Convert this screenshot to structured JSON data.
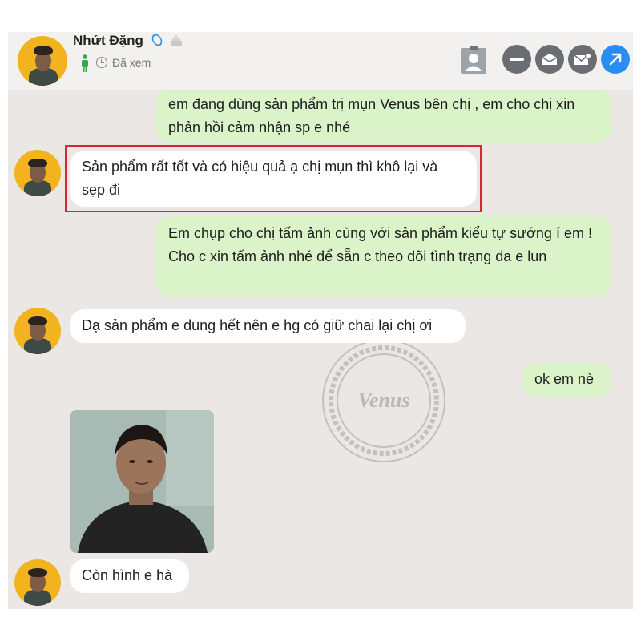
{
  "header": {
    "name": "Nhứt Đặng",
    "status": "Đã xem"
  },
  "icons": {
    "verified": "verified-badge-icon",
    "birthday": "cake-icon",
    "gender": "person-icon",
    "seen": "clock-icon",
    "contact": "contact-card-icon",
    "minimize": "minus-icon",
    "mail_open": "mail-open-icon",
    "mail_new": "mail-new-icon",
    "expand": "arrow-up-right-icon"
  },
  "messages": [
    {
      "side": "out",
      "text": "em đang dùng sản phẩm trị mụn Venus bên chị , em cho chị xin phản hồi cảm nhận sp e nhé"
    },
    {
      "side": "in",
      "text": "Sản phẩm rất tốt và có hiệu quả ạ chị mụn thì khô lại và sẹp đi"
    },
    {
      "side": "out",
      "text": "Em chụp cho chị tấm ảnh cùng với sản phẩm kiểu tự sướng í em ! Cho c xin tấm ảnh nhé để sẵn c theo dõi tình trạng da e lun"
    },
    {
      "side": "in",
      "text": "Dạ sản phẩm e dung hết nên e hg có giữ chai lại chị ơi"
    },
    {
      "side": "out",
      "text": "ok em nè"
    },
    {
      "side": "in",
      "text": "Còn hình e hà"
    }
  ],
  "watermark": {
    "text": "Venus"
  },
  "colors": {
    "chat_bg": "#ebe7e4",
    "outgoing_bubble": "#dbf3c9",
    "incoming_bubble": "#ffffff",
    "highlight_border": "#d8262c",
    "avatar_bg": "#f2b31f",
    "accent_blue": "#2a8cf5"
  }
}
